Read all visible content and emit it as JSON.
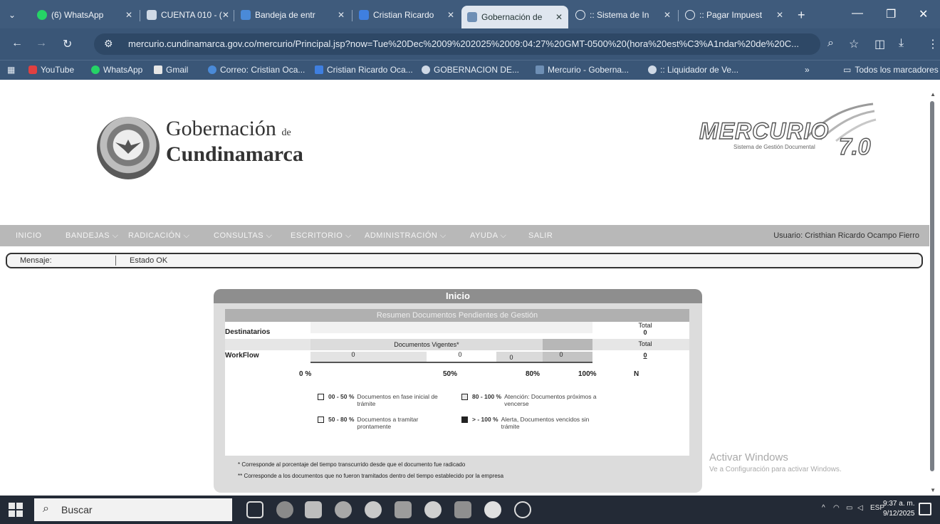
{
  "browser": {
    "tabs": [
      {
        "label": "(6) WhatsApp",
        "active": false
      },
      {
        "label": "CUENTA 010 - (",
        "active": false
      },
      {
        "label": "Bandeja de entr",
        "active": false
      },
      {
        "label": "Cristian Ricardo",
        "active": false
      },
      {
        "label": "Gobernación de",
        "active": true
      },
      {
        "label": ":: Sistema de In",
        "active": false
      },
      {
        "label": ":: Pagar Impuest",
        "active": false
      }
    ],
    "new_tab": "+",
    "url": "mercurio.cundinamarca.gov.co/mercurio/Principal.jsp?now=Tue%20Dec%2009%202025%2009:04:27%20GMT-0500%20(hora%20est%C3%A1ndar%20de%20C...",
    "bookmarks": [
      "YouTube",
      "WhatsApp",
      "Gmail",
      "Correo: Cristian Oca...",
      "Cristian Ricardo Oca...",
      "GOBERNACION DE...",
      "Mercurio - Goberna...",
      ":: Liquidador de Ve..."
    ],
    "bookmarks_more": "»",
    "all_bookmarks": "Todos los marcadores"
  },
  "page": {
    "logo": {
      "line1": "Gobernación",
      "line1_small": "de",
      "line2": "Cundinamarca"
    },
    "mercurio": {
      "word": "MERCURIO",
      "version": "7.0",
      "subtitle": "Sistema de Gestión Documental"
    },
    "menu": [
      "INICIO",
      "BANDEJAS",
      "RADICACIÓN",
      "CONSULTAS",
      "ESCRITORIO",
      "ADMINISTRACIÓN",
      "AYUDA",
      "SALIR"
    ],
    "user": "Usuario: Cristhian Ricardo Ocampo Fierro",
    "message": {
      "label": "Mensaje:",
      "value": "Estado OK"
    }
  },
  "panel": {
    "title": "Inicio",
    "summary_title": "Resumen Documentos Pendientes de Gestión",
    "destinatarios_label": "Destinatarios",
    "workflow_label": "WorkFlow",
    "total_label_1": "Total",
    "total_value_1": "0",
    "total_label_2": "Total",
    "total_value_2": "0",
    "vigentes_label": "Documentos Vigentes*",
    "workflow_values": [
      "0",
      "0",
      "0",
      "0"
    ],
    "progress": {
      "green": 50,
      "yellow": 30,
      "orange": 20
    },
    "scale": [
      "0 %",
      "50%",
      "80%",
      "100%",
      "N"
    ],
    "legend": [
      {
        "range": "00 - 50 %",
        "desc": "Documentos en fase inicial de trámite",
        "color": "#ffffff"
      },
      {
        "range": "80 - 100 %",
        "desc": "Atención: Documentos próximos a vencerse",
        "color": "#e8e8e8"
      },
      {
        "range": "50 - 80 %",
        "desc": "Documentos a tramitar prontamente",
        "color": "#f4f4f4"
      },
      {
        "range": "> - 100 %",
        "desc": "Alerta, Documentos vencidos sin trámite",
        "color": "#222222"
      }
    ],
    "footnote1": "* Corresponde al porcentaje del tiempo transcurrido desde que el documento fue radicado",
    "footnote2": "** Corresponde a los documentos que no fueron tramitados dentro del tiempo establecido por la empresa"
  },
  "windows_activation": {
    "title": "Activar Windows",
    "subtitle": "Ve a Configuración para activar Windows."
  },
  "taskbar": {
    "search_placeholder": "Buscar",
    "tray_lang": "ESP",
    "time": "9:37 a. m.",
    "date": "9/12/2025"
  }
}
